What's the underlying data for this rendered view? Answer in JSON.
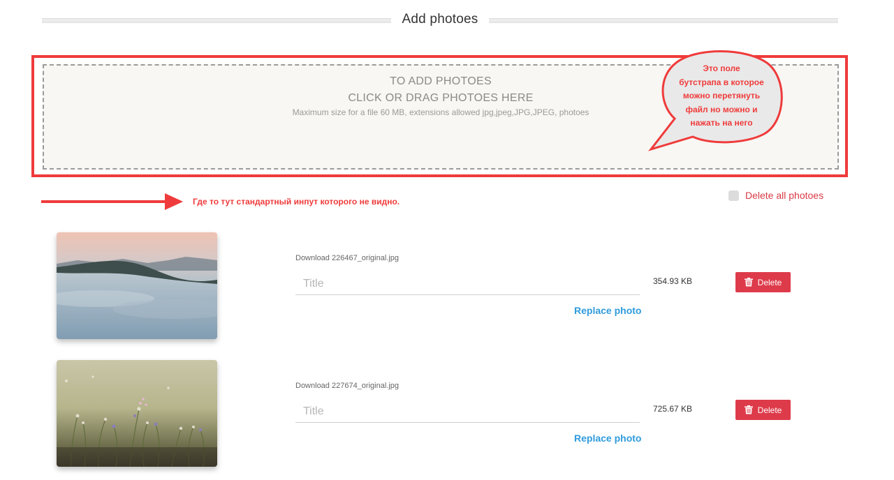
{
  "header": {
    "title": "Add photoes"
  },
  "dropzone": {
    "line1": "TO ADD PHOTOES",
    "line2": "CLICK OR DRAG PHOTOES HERE",
    "hint": "Maximum size for a file 60 MB, extensions allowed jpg,jpeg,JPG,JPEG, photoes"
  },
  "annotations": {
    "bubble_lines": [
      "Это поле",
      "бутстрапа в которое",
      "можно перетянуть",
      "файл но можно и",
      "нажать на него"
    ],
    "arrow_text": "Где то тут стандартный инпут которого не видно."
  },
  "delete_all": {
    "label": "Delete all photoes"
  },
  "photos": [
    {
      "filename": "Download 226467_original.jpg",
      "title_placeholder": "Title",
      "title_value": "",
      "replace_label": "Replace photo",
      "size": "354.93 KB",
      "delete_label": "Delete"
    },
    {
      "filename": "Download 227674_original.jpg",
      "title_placeholder": "Title",
      "title_value": "",
      "replace_label": "Replace photo",
      "size": "725.67 KB",
      "delete_label": "Delete"
    }
  ],
  "colors": {
    "annotation_red": "#ef3b3b",
    "delete_red": "#de3b4a",
    "link_blue": "#2f9bdc",
    "dropzone_bg": "#f8f7f3"
  },
  "icons": {
    "delete_button": "trash-icon",
    "thumbnail_1": "misty-hills-photo",
    "thumbnail_2": "wildflowers-photo"
  }
}
